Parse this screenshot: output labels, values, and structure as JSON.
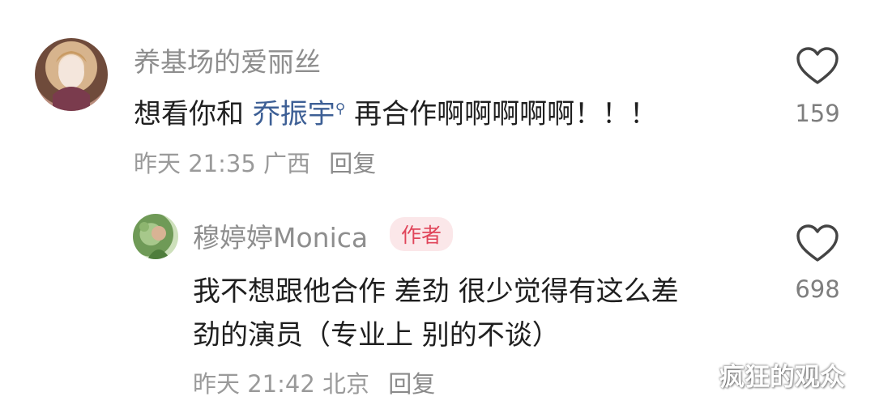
{
  "comments": [
    {
      "username": "养基场的爱丽丝",
      "text_before": "想看你和 ",
      "mention": "乔振宇",
      "mention_icon": "search-icon",
      "text_after": " 再合作啊啊啊啊啊！！！",
      "time": "昨天 21:35",
      "location": "广西",
      "reply_label": "回复",
      "likes": "159"
    },
    {
      "username": "穆婷婷Monica",
      "badge": "作者",
      "text_line1": "我不想跟他合作 差劲 很少觉得有这么差",
      "text_line2": "劲的演员（专业上 别的不谈）",
      "time": "昨天 21:42",
      "location": "北京",
      "reply_label": "回复",
      "likes": "698"
    }
  ],
  "watermark": "疯狂的观众",
  "colors": {
    "mention": "#3d5f95",
    "badge_bg": "#fbe7e9",
    "badge_text": "#e0455a",
    "meta": "#9a9a9a"
  }
}
